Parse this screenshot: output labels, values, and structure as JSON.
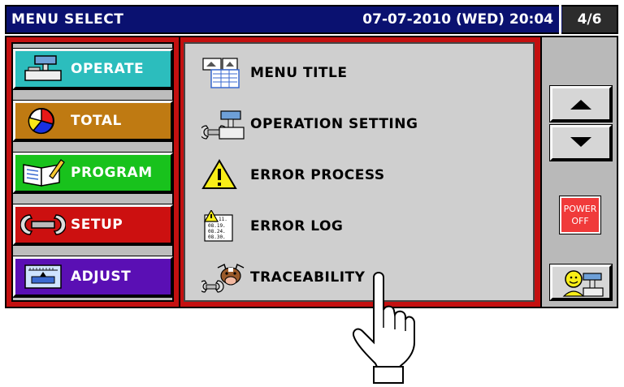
{
  "header": {
    "title": "MENU SELECT",
    "datetime": "07-07-2010 (WED) 20:04",
    "page": "4/6"
  },
  "categories": [
    {
      "label": "OPERATE",
      "icon": "scale-icon",
      "color": "#2cbdbd"
    },
    {
      "label": "TOTAL",
      "icon": "pie-chart-icon",
      "color": "#bf7a12"
    },
    {
      "label": "PROGRAM",
      "icon": "book-pencil-icon",
      "color": "#18c21c"
    },
    {
      "label": "SETUP",
      "icon": "wrench-icon",
      "color": "#cc1010"
    },
    {
      "label": "ADJUST",
      "icon": "adjust-panel-icon",
      "color": "#5a0fb4"
    }
  ],
  "menu_items": [
    {
      "label": "MENU TITLE",
      "icon": "menu-title-icon"
    },
    {
      "label": "OPERATION SETTING",
      "icon": "operation-setting-icon"
    },
    {
      "label": "ERROR PROCESS",
      "icon": "warning-icon"
    },
    {
      "label": "ERROR LOG",
      "icon": "error-log-icon"
    },
    {
      "label": "TRACEABILITY",
      "icon": "cow-icon"
    }
  ],
  "error_log_icon_lines": [
    "11.",
    "08.19.",
    "08.24.",
    "08.30."
  ],
  "controls": {
    "up": "up-arrow-icon",
    "down": "down-arrow-icon",
    "power_line1": "POWER",
    "power_line2": "OFF",
    "operator": "operator-icon"
  },
  "colors": {
    "header_bg": "#0a1170",
    "frame_red": "#c41010",
    "panel_gray": "#cfcfcf"
  }
}
